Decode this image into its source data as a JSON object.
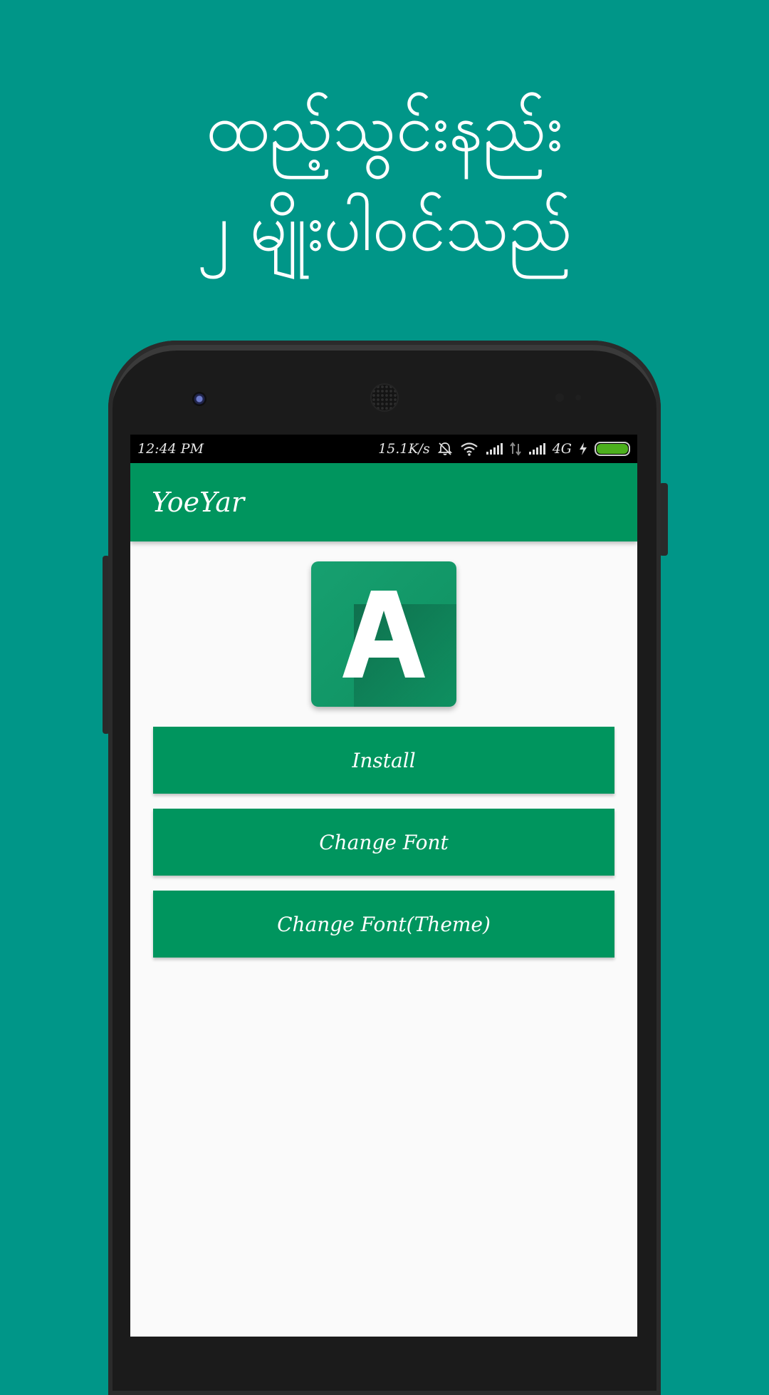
{
  "headline": {
    "line1": "ထည့်သွင်းနည်း",
    "line2": "၂ မျိုးပါဝင်သည်"
  },
  "status_bar": {
    "time": "12:44 PM",
    "speed": "15.1K/s",
    "network": "4G",
    "icons": [
      "alarm-off-icon",
      "wifi-icon",
      "signal-icon",
      "data-arrows-icon",
      "signal-icon",
      "charging-bolt-icon",
      "battery-icon"
    ],
    "battery_level": 1.0
  },
  "app_bar": {
    "title": "YoeYar"
  },
  "logo": {
    "letter": "A",
    "colors": {
      "tile": "#17a070",
      "letter": "#ffffff"
    }
  },
  "buttons": [
    {
      "label": "Install"
    },
    {
      "label": "Change Font"
    },
    {
      "label": "Change Font(Theme)"
    }
  ],
  "colors": {
    "background": "#009688",
    "primary": "#00955e",
    "screen_bg": "#fafafa",
    "battery": "#4caf1d"
  }
}
